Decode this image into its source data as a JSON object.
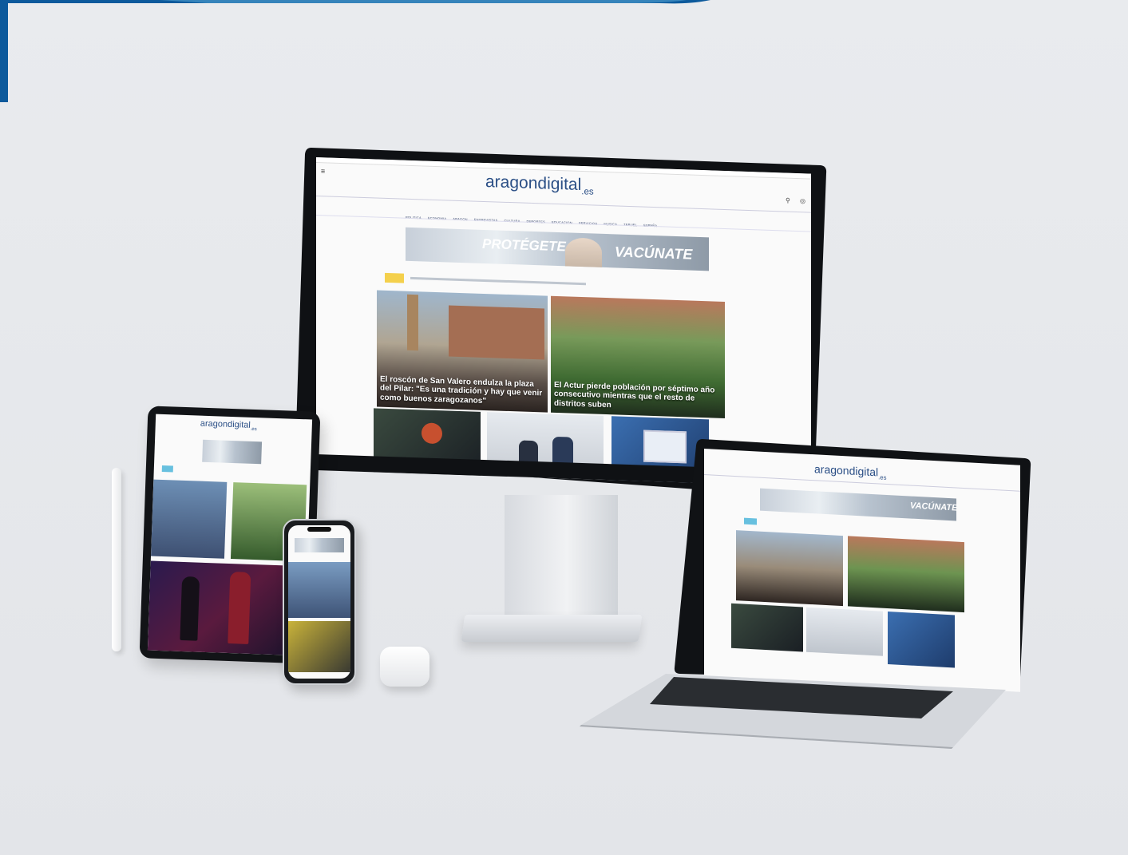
{
  "brand": {
    "name": "aragondigital",
    "tld": ".es",
    "sub_mark": "a"
  },
  "desktop": {
    "nav": [
      "POLITICA",
      "ECONOMIA",
      "ARAGON",
      "ENTREVISTAS",
      "CULTURA",
      "DEPORTES",
      "EDUCACION",
      "SERVICIOS",
      "MUSICA",
      "TERUEL",
      "ESPAÑA"
    ],
    "banner": {
      "left": "PROTÉGETE,",
      "right": "VACÚNATE"
    },
    "headline_1": "El roscón de San Valero endulza la plaza del Pilar: \"Es una tradición y hay que venir como buenos zaragozanos\"",
    "headline_2": "El Actur pierde población por séptimo año consecutivo mientras que el resto de distritos suben"
  },
  "colors": {
    "brand_blue": "#2b4f86",
    "corner_blue": "#0a5aa0"
  }
}
